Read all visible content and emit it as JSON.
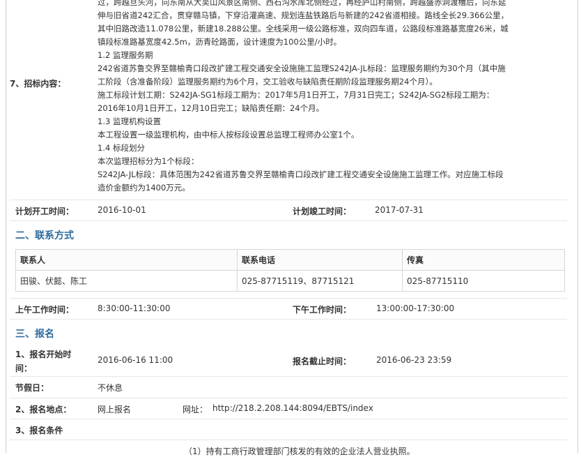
{
  "section_bid": {
    "label": "7、招标内容：",
    "lines": [
      "过，跨越旦头河，向东南从大吴山风景区南侧、西石沟水库北侧经过，再经庐山村南侧，跨越盛赤洞渡槽后，向东延",
      "伸与旧省道242汇合，贯穿赣马镇，下穿沿灌高速、规划连盐铁路后与新建的242省道相接。路线全长29.366公里，",
      "其中旧路改造11.078公里，新建18.288公里。全线采用一级公路标准，双向四车道，公路段标准路基宽度26米，城",
      "镇段标准路基宽度42.5m，沥青砼路面，设计速度为100公里/小时。",
      "1.2 监理服务期",
      "242省道苏鲁交界至赣榆青口段改扩建工程交通安全设施施工监理S242JA-JL标段：监理服务期约为30个月（其中施",
      "工阶段（含准备阶段）监理服务期约为6个月，交工验收与缺陷责任期阶段监理服务期24个月）。",
      "施工标段计划工期：S242JA-SG1标段工期为：2017年5月1日开工，7月31日完工；S242JA-SG2标段工期为：",
      "2016年10月1日开工，12月10日完工；缺陷责任期：24个月。",
      "1.3 监理机构设置",
      "本工程设置一级监理机构，由中标人按标段设置总监理工程师办公室1个。",
      "1.4 标段划分",
      "本次监理招标分为1个标段：",
      "S242JA-JL标段：具体范围为242省道苏鲁交界至赣榆青口段改扩建工程交通安全设施施工监理工作。对应施工标段",
      "造价金额约为1400万元。"
    ]
  },
  "plan": {
    "start_label": "计划开工时间：",
    "start_value": "2016-10-01",
    "end_label": "计划竣工时间：",
    "end_value": "2017-07-31"
  },
  "contact_section": {
    "title": "二、联系方式",
    "headers": [
      "联系人",
      "联系电话",
      "传真"
    ],
    "row": [
      "田骏、伏懿、陈工",
      "025-87715119、87715121",
      "025-87715110"
    ],
    "am_label": "上午工作时间：",
    "am_value": "8:30:00-11:30:00",
    "pm_label": "下午工作时间：",
    "pm_value": "13:00:00-17:30:00"
  },
  "signup_section": {
    "title": "三、报名",
    "start_label_1": "1、报名开始时",
    "start_label_2": "间：",
    "start_value": "2016-06-16 11:00",
    "end_label": "报名截止时间：",
    "end_value": "2016-06-23 23:59",
    "holiday_label": "节假日：",
    "holiday_value": "不休息",
    "place_label": "2、报名地点：",
    "place_value": "网上报名",
    "url_label": "网址：",
    "url_value": "http://218.2.208.144:8094/EBTS/index",
    "cond_label": "3、报名条件",
    "cond_first": "（1）持有工商行政管理部门核发的有效的企业法人营业执照。"
  }
}
